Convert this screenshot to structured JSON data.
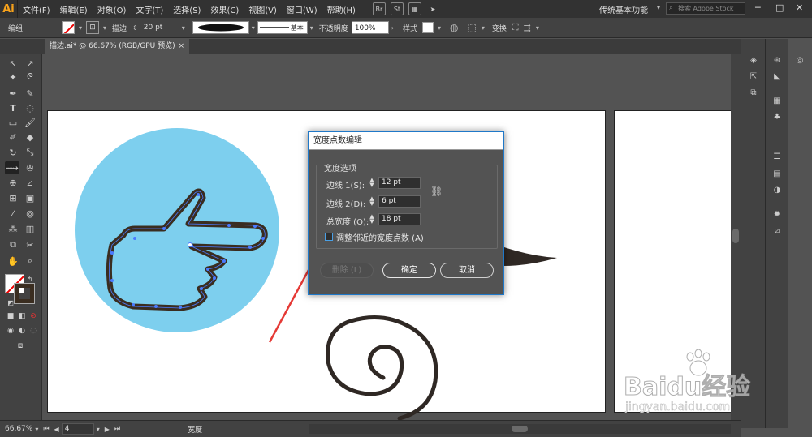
{
  "app": {
    "logo": "Ai"
  },
  "menu": {
    "items": [
      "文件(F)",
      "编辑(E)",
      "对象(O)",
      "文字(T)",
      "选择(S)",
      "效果(C)",
      "视图(V)",
      "窗口(W)",
      "帮助(H)"
    ],
    "bridge": "Br",
    "stock": "St",
    "workspace": "传统基本功能",
    "search_placeholder": "搜索 Adobe Stock"
  },
  "control": {
    "mode_label": "编组",
    "stroke_label": "描边",
    "stroke_value": "20 pt",
    "stroke_style": "基本",
    "opacity_label": "不透明度",
    "opacity_value": "100%",
    "style_label": "样式",
    "transform_label": "变换"
  },
  "document": {
    "tab_title": "描边.ai* @ 66.67% (RGB/GPU 预览)",
    "close": "×"
  },
  "status": {
    "zoom": "66.67%",
    "page": "4",
    "tool": "宽度"
  },
  "dialog": {
    "title": "宽度点数编辑",
    "group_label": "宽度选项",
    "side1_label": "边线 1(S):",
    "side1_value": "12 pt",
    "side2_label": "边线 2(D):",
    "side2_value": "6 pt",
    "total_label": "总宽度 (O):",
    "total_value": "18 pt",
    "adjust_label": "调整邻近的宽度点数 (A)",
    "delete_label": "删除 (L)",
    "ok_label": "确定",
    "cancel_label": "取消"
  },
  "watermark": {
    "main": "Bai",
    "du": "du",
    "cn": "经验",
    "sub": "jingyan.baidu.com"
  },
  "colors": {
    "accent": "#1f78c8",
    "circle": "#7dcfee",
    "stroke": "#3a2d20",
    "arrow": "#e53935"
  }
}
